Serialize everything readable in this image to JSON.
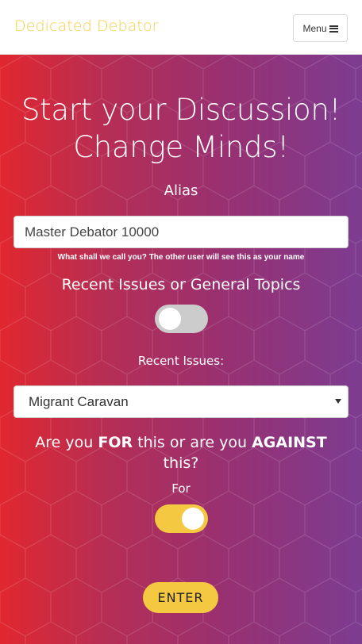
{
  "navbar": {
    "brand": "Dedicated Debator",
    "menu_label": "Menu",
    "menu_icon": "hamburger-icon"
  },
  "hero": {
    "title_line1": "Start your Discussion!",
    "title_line2": "Change Minds!",
    "alias_label": "Alias",
    "alias_value": "Master Debator 10000",
    "alias_help": "What shall we call you? The other user will see this as your name",
    "topic_toggle_label": "Recent Issues or General Topics",
    "topic_toggle_on": false,
    "recent_label": "Recent Issues:",
    "recent_selected": "Migrant Caravan",
    "stance_q_part1": "Are you ",
    "stance_q_for": "FOR",
    "stance_q_part2": " this or are you ",
    "stance_q_against": "AGAINST",
    "stance_q_part3": " this?",
    "stance_value": "For",
    "stance_toggle_on": true,
    "enter_label": "ENTER"
  },
  "colors": {
    "brand": "#f2cf4a",
    "accent": "#f5c842",
    "gradient_start": "#e1272f",
    "gradient_end": "#7c3c91",
    "toggle_off": "#cccccc"
  }
}
